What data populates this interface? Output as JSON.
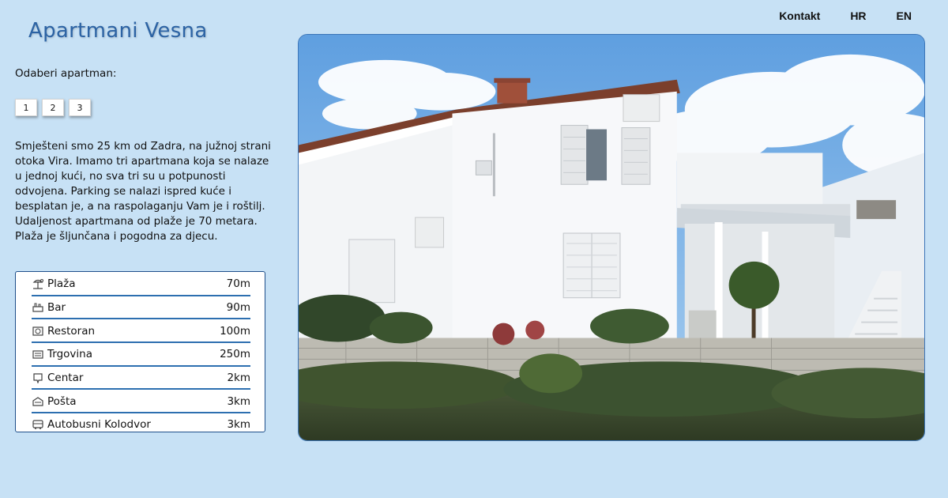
{
  "nav": {
    "contact": "Kontakt",
    "lang_hr": "HR",
    "lang_en": "EN"
  },
  "site_title": "Apartmani Vesna",
  "apartment_selector": {
    "label": "Odaberi apartman:",
    "buttons": [
      "1",
      "2",
      "3"
    ]
  },
  "intro_text": "Smješteni smo 25 km od Zadra, na južnoj strani otoka Vira. Imamo tri apartmana koja se nalaze u jednoj kući, no sva tri su u potpunosti odvojena. Parking se nalazi ispred kuće i besplatan je, a na raspolaganju Vam je i roštilj. Udaljenost apartmana od plaže je 70 metara. Plaža je šljunčana i pogodna za djecu.",
  "distances": [
    {
      "icon": "beach-icon",
      "name": "Plaža",
      "value": "70m"
    },
    {
      "icon": "bar-icon",
      "name": "Bar",
      "value": "90m"
    },
    {
      "icon": "restaurant-icon",
      "name": "Restoran",
      "value": "100m"
    },
    {
      "icon": "shop-icon",
      "name": "Trgovina",
      "value": "250m"
    },
    {
      "icon": "center-icon",
      "name": "Centar",
      "value": "2km"
    },
    {
      "icon": "post-icon",
      "name": "Pošta",
      "value": "3km"
    },
    {
      "icon": "bus-icon",
      "name": "Autobusni Kolodvor",
      "value": "3km"
    }
  ],
  "colors": {
    "background": "#c7e1f5",
    "title": "#2c63a4",
    "divider": "#2d6fb0"
  }
}
